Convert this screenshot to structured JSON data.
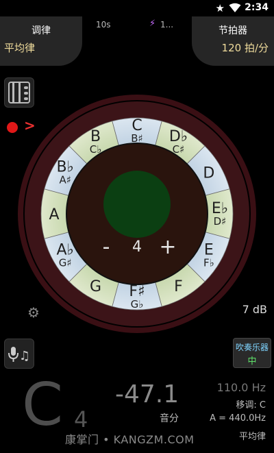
{
  "status": {
    "time": "2:34"
  },
  "header": {
    "temperament_title": "调律",
    "temperament_value": "平均律",
    "metronome_title": "节拍器",
    "metronome_value": "120 拍/分",
    "timer": "10s",
    "bolt_count": "1..."
  },
  "side": {
    "record_arrow": ">",
    "db": "7 dB"
  },
  "wheel": {
    "notes": [
      {
        "main": "C",
        "sub": "B♯"
      },
      {
        "main": "D♭",
        "sub": "C♯"
      },
      {
        "main": "D",
        "sub": ""
      },
      {
        "main": "E♭",
        "sub": "D♯"
      },
      {
        "main": "E",
        "sub": "F♭"
      },
      {
        "main": "F",
        "sub": ""
      },
      {
        "main": "F♯",
        "sub": "G♭"
      },
      {
        "main": "G",
        "sub": ""
      },
      {
        "main": "A♭",
        "sub": "G♯"
      },
      {
        "main": "A",
        "sub": ""
      },
      {
        "main": "B♭",
        "sub": "A♯"
      },
      {
        "main": "B",
        "sub": "C♭"
      }
    ],
    "minus": "-",
    "count": "4",
    "plus": "+"
  },
  "wind": {
    "label": "吹奏乐器",
    "level": "中"
  },
  "readout": {
    "note": "C",
    "octave": "4",
    "cents": "-47.1",
    "cents_unit": "音分",
    "frequency": "110.0 Hz",
    "transpose": "移调: C",
    "a_ref": "A = 440.0Hz",
    "temperament": "平均律"
  },
  "watermark": "康掌门 • KANGZM.COM",
  "colors": {
    "accent_text": "#f0dc9c",
    "record": "#e01818",
    "wind_label": "#7fd4ff",
    "wind_level": "#5fe36a"
  }
}
